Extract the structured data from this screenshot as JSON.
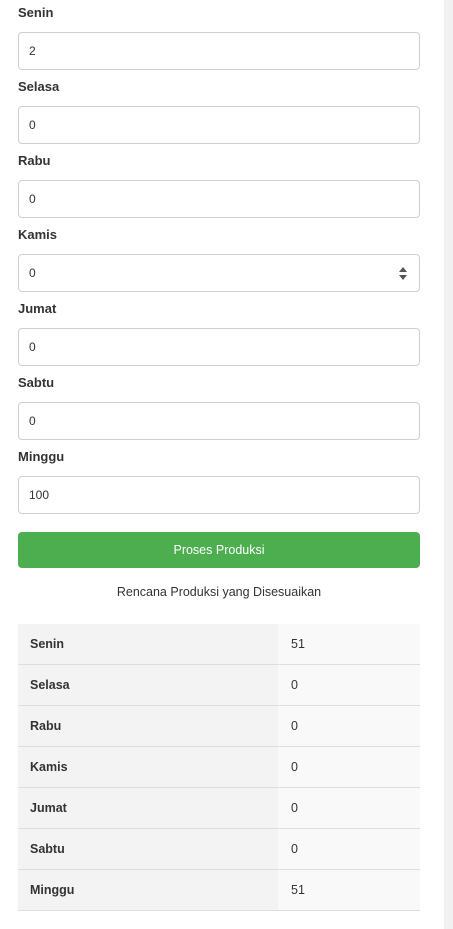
{
  "form": {
    "fields": [
      {
        "label": "Senin",
        "value": "2"
      },
      {
        "label": "Selasa",
        "value": "0"
      },
      {
        "label": "Rabu",
        "value": "0"
      },
      {
        "label": "Kamis",
        "value": "0"
      },
      {
        "label": "Jumat",
        "value": "0"
      },
      {
        "label": "Sabtu",
        "value": "0"
      },
      {
        "label": "Minggu",
        "value": "100"
      }
    ],
    "submit_label": "Proses Produksi"
  },
  "result": {
    "title": "Rencana Produksi yang Disesuaikan",
    "rows": [
      {
        "day": "Senin",
        "value": "51"
      },
      {
        "day": "Selasa",
        "value": "0"
      },
      {
        "day": "Rabu",
        "value": "0"
      },
      {
        "day": "Kamis",
        "value": "0"
      },
      {
        "day": "Jumat",
        "value": "0"
      },
      {
        "day": "Sabtu",
        "value": "0"
      },
      {
        "day": "Minggu",
        "value": "51"
      }
    ]
  },
  "colors": {
    "button": "#4cae4f"
  }
}
